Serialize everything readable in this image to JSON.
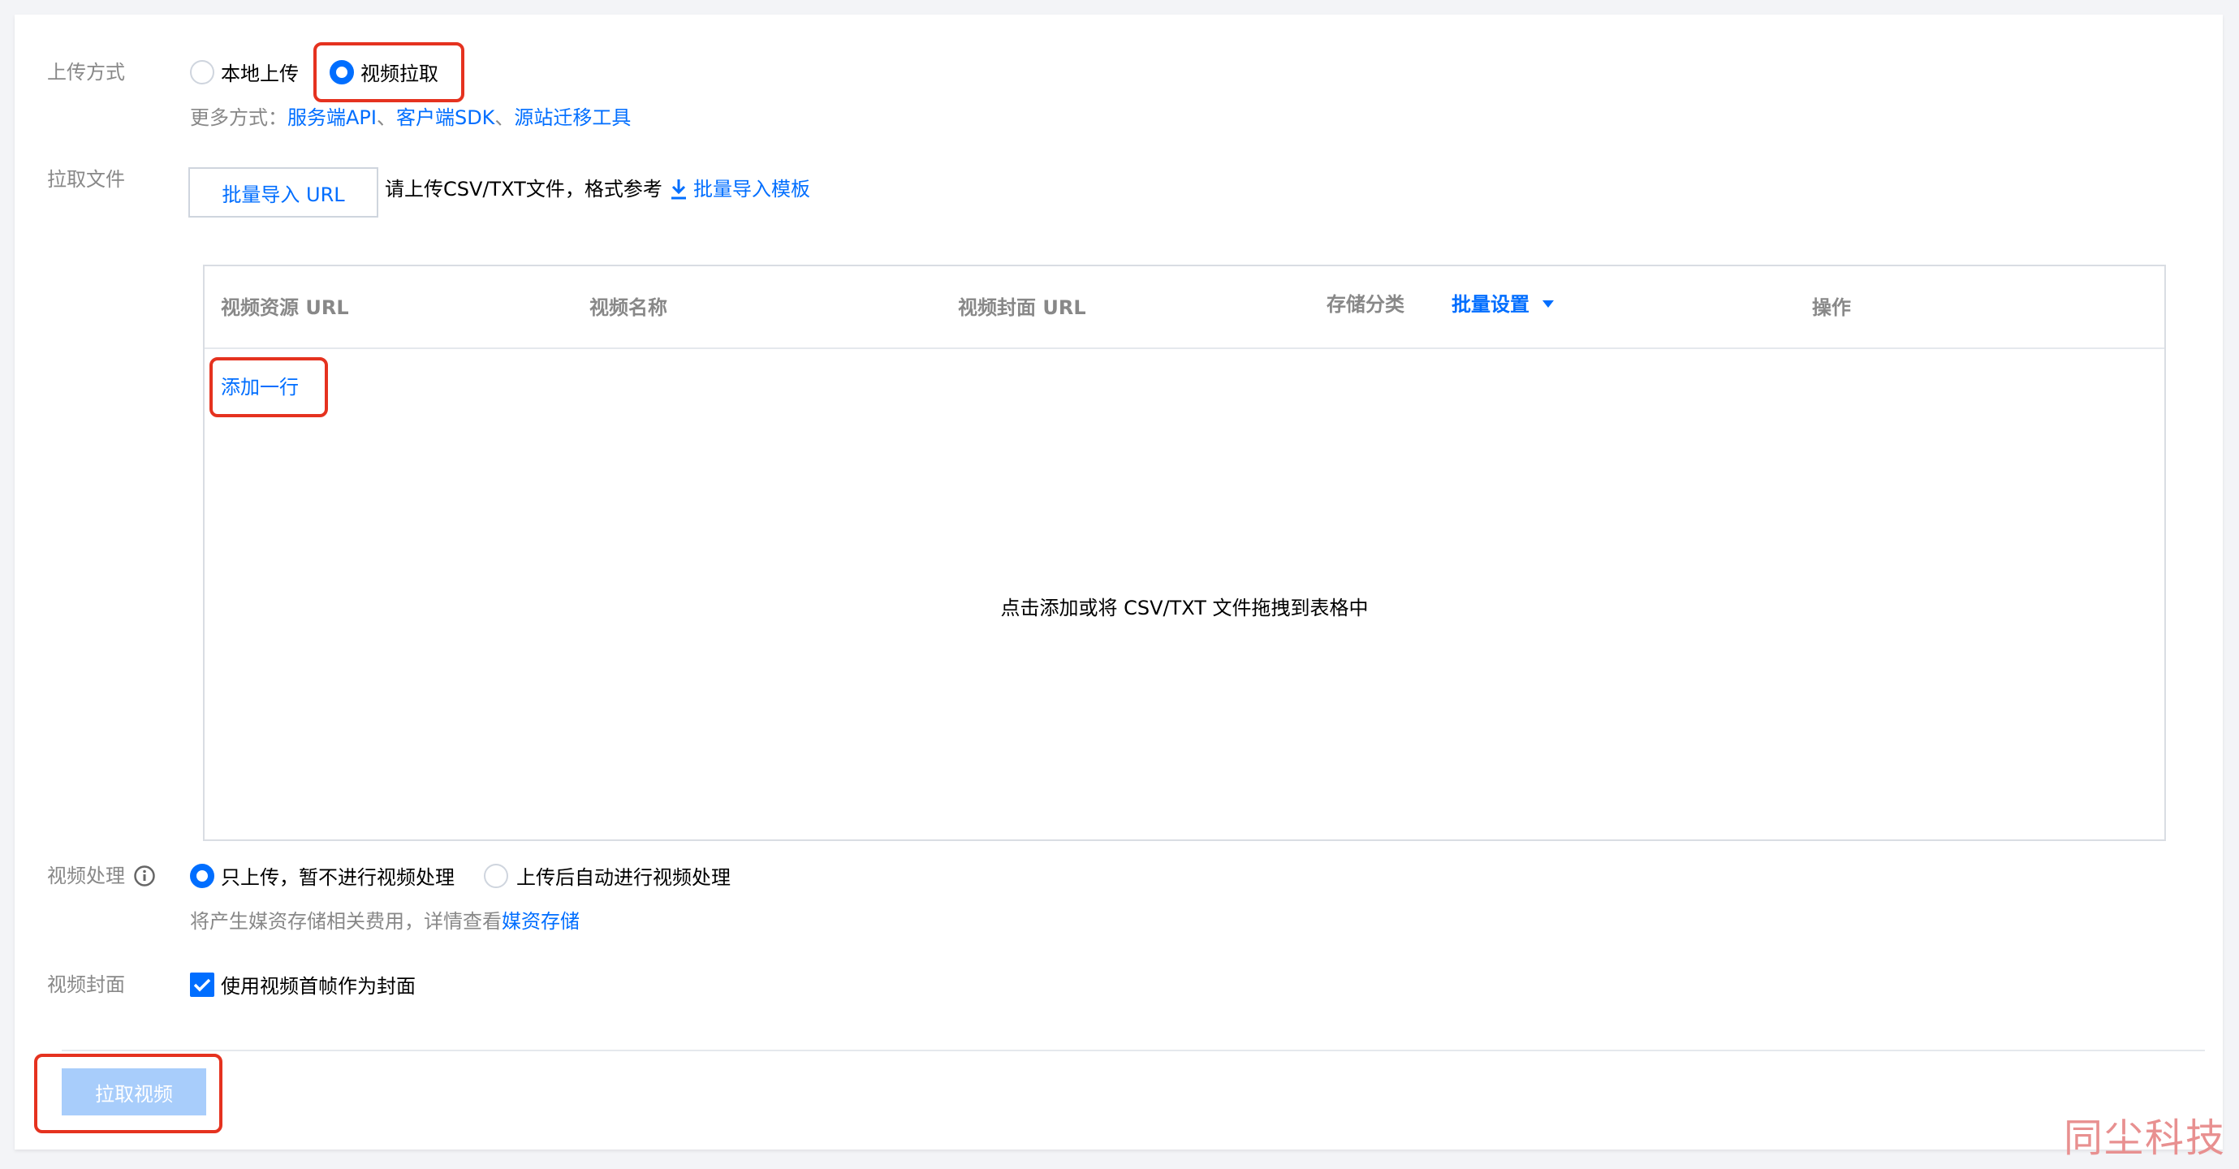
{
  "upload_method": {
    "label": "上传方式",
    "options": [
      "本地上传",
      "视频拉取"
    ],
    "selected": "视频拉取"
  },
  "more_methods": {
    "prefix": "更多方式：",
    "links": [
      "服务端API",
      "客户端SDK",
      "源站迁移工具"
    ],
    "separator": "、"
  },
  "pull_file": {
    "label": "拉取文件",
    "import_button": "批量导入 URL",
    "hint": "请上传CSV/TXT文件，格式参考",
    "template_link": "批量导入模板"
  },
  "table": {
    "columns": {
      "url": "视频资源 URL",
      "name": "视频名称",
      "cover": "视频封面 URL",
      "category": "存储分类",
      "batch": "批量设置",
      "action": "操作"
    },
    "add_row": "添加一行",
    "empty_text": "点击添加或将 CSV/TXT 文件拖拽到表格中"
  },
  "processing": {
    "label": "视频处理",
    "options": [
      "只上传，暂不进行视频处理",
      "上传后自动进行视频处理"
    ],
    "selected": "只上传，暂不进行视频处理",
    "note_prefix": "将产生媒资存储相关费用，详情查看",
    "note_link": "媒资存储"
  },
  "cover": {
    "label": "视频封面",
    "checkbox_label": "使用视频首帧作为封面",
    "checked": true
  },
  "submit_button": "拉取视频",
  "watermark": "同尘科技",
  "colors": {
    "accent": "#006eff",
    "highlight": "#e5321f",
    "disabled_button": "#a8cdfb"
  }
}
